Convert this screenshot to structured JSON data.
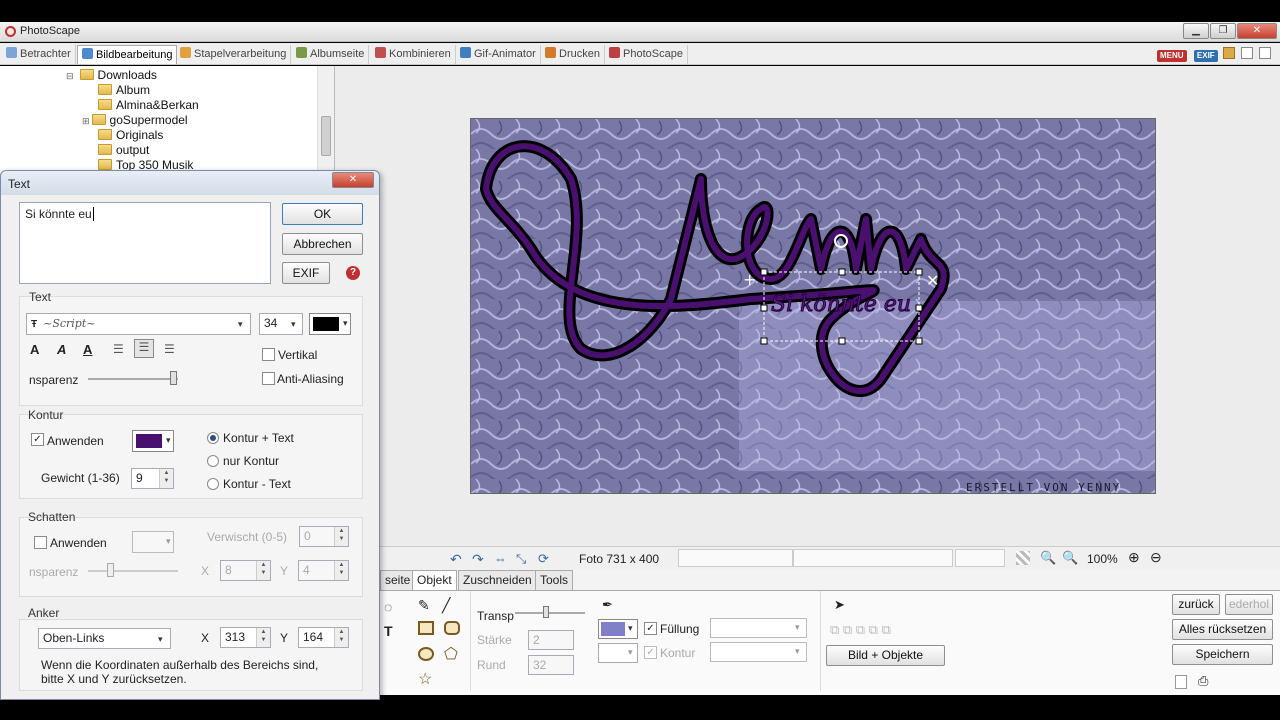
{
  "app": {
    "title": "PhotoScape",
    "tabs": [
      {
        "label": "Betrachter",
        "color": "#7aa5d6"
      },
      {
        "label": "Bildbearbeitung",
        "color": "#4f8ad1"
      },
      {
        "label": "Stapelverarbeitung",
        "color": "#e2a13c"
      },
      {
        "label": "Albumseite",
        "color": "#7a9a4a"
      },
      {
        "label": "Kombinieren",
        "color": "#c0504d"
      },
      {
        "label": "Gif-Animator",
        "color": "#3f7fbf"
      },
      {
        "label": "Drucken",
        "color": "#d07a2a"
      },
      {
        "label": "PhotoScape",
        "color": "#c04040"
      }
    ],
    "right_badges": [
      "MENU",
      "EXIF"
    ]
  },
  "tree": {
    "items": [
      "Downloads",
      "Album",
      "Almina&Berkan",
      "goSupermodel",
      "Originals",
      "output",
      "Top 350 Musik"
    ]
  },
  "dialog": {
    "title": "Text",
    "text_value": "Si könnte eu",
    "ok": "OK",
    "cancel": "Abbrechen",
    "exif": "EXIF",
    "text_group": {
      "label": "Text",
      "font_size": "34",
      "font_color": "#000000",
      "vertical": "Vertikal",
      "antialias": "Anti-Aliasing",
      "transparency": "nsparenz"
    },
    "kontur": {
      "label": "Kontur",
      "apply": "Anwenden",
      "apply_checked": true,
      "color": "#4a1070",
      "weight_label": "Gewicht (1-36)",
      "weight": "9",
      "options": [
        "Kontur + Text",
        "nur Kontur",
        "Kontur - Text"
      ],
      "selected": 0
    },
    "schatten": {
      "label": "Schatten",
      "apply": "Anwenden",
      "blur_label": "Verwischt (0-5)",
      "blur": "0",
      "transparency": "nsparenz",
      "x_label": "X",
      "x": "8",
      "y_label": "Y",
      "y": "4"
    },
    "anker": {
      "label": "Anker",
      "position": "Oben-Links",
      "x_label": "X",
      "x": "313",
      "y_label": "Y",
      "y": "164",
      "note": "Wenn die Koordinaten außerhalb des Bereichs sind, bitte X und Y zurücksetzen."
    }
  },
  "photo": {
    "big_text": "Yenny",
    "small_text": "Si könnte eu",
    "watermark": "ERSTELLT VON YENNY"
  },
  "status": {
    "photo_info": "Foto 731 x 400",
    "zoom": "100%"
  },
  "bottom": {
    "tabs": [
      "seite",
      "Objekt",
      "Zuschneiden",
      "Tools"
    ],
    "active_tab": "Objekt",
    "transp_label": "Transp",
    "staerke_label": "Stärke",
    "staerke": "2",
    "rund_label": "Rund",
    "rund": "32",
    "fill_label": "Füllung",
    "kontur_label": "Kontur",
    "fill_color": "#8080c8",
    "bild_objekte": "Bild + Objekte",
    "zurueck": "zurück",
    "wiederholen": "ederhol",
    "alles_zurueck": "Alles rücksetzen",
    "speichern": "Speichern"
  }
}
